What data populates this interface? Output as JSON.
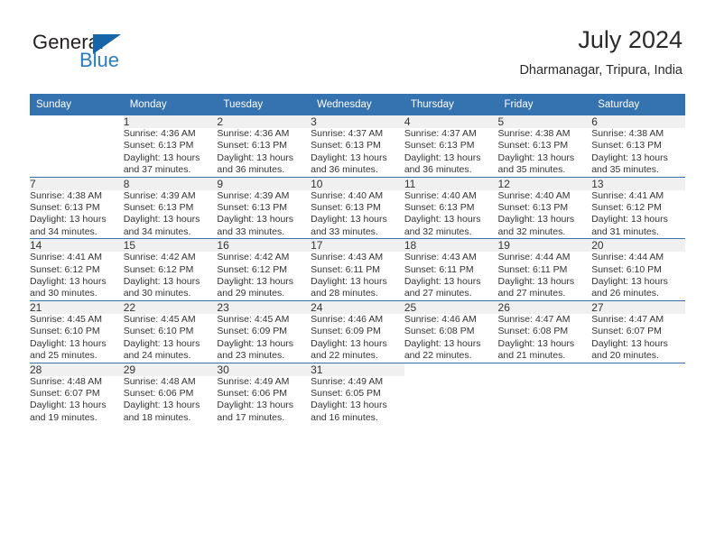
{
  "brand": {
    "name_part1": "General",
    "name_part2": "Blue",
    "flag_color": "#1565a8",
    "blue_color": "#2b7cc2"
  },
  "header": {
    "title": "July 2024",
    "location": "Dharmanagar, Tripura, India"
  },
  "calendar": {
    "header_bg": "#3572b0",
    "daynum_bg": "#f0f0f0",
    "weekdays": [
      "Sunday",
      "Monday",
      "Tuesday",
      "Wednesday",
      "Thursday",
      "Friday",
      "Saturday"
    ],
    "weeks": [
      [
        {
          "day": "",
          "sunrise": "",
          "sunset": "",
          "daylight_line1": "",
          "daylight_line2": ""
        },
        {
          "day": "1",
          "sunrise": "Sunrise: 4:36 AM",
          "sunset": "Sunset: 6:13 PM",
          "daylight_line1": "Daylight: 13 hours",
          "daylight_line2": "and 37 minutes."
        },
        {
          "day": "2",
          "sunrise": "Sunrise: 4:36 AM",
          "sunset": "Sunset: 6:13 PM",
          "daylight_line1": "Daylight: 13 hours",
          "daylight_line2": "and 36 minutes."
        },
        {
          "day": "3",
          "sunrise": "Sunrise: 4:37 AM",
          "sunset": "Sunset: 6:13 PM",
          "daylight_line1": "Daylight: 13 hours",
          "daylight_line2": "and 36 minutes."
        },
        {
          "day": "4",
          "sunrise": "Sunrise: 4:37 AM",
          "sunset": "Sunset: 6:13 PM",
          "daylight_line1": "Daylight: 13 hours",
          "daylight_line2": "and 36 minutes."
        },
        {
          "day": "5",
          "sunrise": "Sunrise: 4:38 AM",
          "sunset": "Sunset: 6:13 PM",
          "daylight_line1": "Daylight: 13 hours",
          "daylight_line2": "and 35 minutes."
        },
        {
          "day": "6",
          "sunrise": "Sunrise: 4:38 AM",
          "sunset": "Sunset: 6:13 PM",
          "daylight_line1": "Daylight: 13 hours",
          "daylight_line2": "and 35 minutes."
        }
      ],
      [
        {
          "day": "7",
          "sunrise": "Sunrise: 4:38 AM",
          "sunset": "Sunset: 6:13 PM",
          "daylight_line1": "Daylight: 13 hours",
          "daylight_line2": "and 34 minutes."
        },
        {
          "day": "8",
          "sunrise": "Sunrise: 4:39 AM",
          "sunset": "Sunset: 6:13 PM",
          "daylight_line1": "Daylight: 13 hours",
          "daylight_line2": "and 34 minutes."
        },
        {
          "day": "9",
          "sunrise": "Sunrise: 4:39 AM",
          "sunset": "Sunset: 6:13 PM",
          "daylight_line1": "Daylight: 13 hours",
          "daylight_line2": "and 33 minutes."
        },
        {
          "day": "10",
          "sunrise": "Sunrise: 4:40 AM",
          "sunset": "Sunset: 6:13 PM",
          "daylight_line1": "Daylight: 13 hours",
          "daylight_line2": "and 33 minutes."
        },
        {
          "day": "11",
          "sunrise": "Sunrise: 4:40 AM",
          "sunset": "Sunset: 6:13 PM",
          "daylight_line1": "Daylight: 13 hours",
          "daylight_line2": "and 32 minutes."
        },
        {
          "day": "12",
          "sunrise": "Sunrise: 4:40 AM",
          "sunset": "Sunset: 6:13 PM",
          "daylight_line1": "Daylight: 13 hours",
          "daylight_line2": "and 32 minutes."
        },
        {
          "day": "13",
          "sunrise": "Sunrise: 4:41 AM",
          "sunset": "Sunset: 6:12 PM",
          "daylight_line1": "Daylight: 13 hours",
          "daylight_line2": "and 31 minutes."
        }
      ],
      [
        {
          "day": "14",
          "sunrise": "Sunrise: 4:41 AM",
          "sunset": "Sunset: 6:12 PM",
          "daylight_line1": "Daylight: 13 hours",
          "daylight_line2": "and 30 minutes."
        },
        {
          "day": "15",
          "sunrise": "Sunrise: 4:42 AM",
          "sunset": "Sunset: 6:12 PM",
          "daylight_line1": "Daylight: 13 hours",
          "daylight_line2": "and 30 minutes."
        },
        {
          "day": "16",
          "sunrise": "Sunrise: 4:42 AM",
          "sunset": "Sunset: 6:12 PM",
          "daylight_line1": "Daylight: 13 hours",
          "daylight_line2": "and 29 minutes."
        },
        {
          "day": "17",
          "sunrise": "Sunrise: 4:43 AM",
          "sunset": "Sunset: 6:11 PM",
          "daylight_line1": "Daylight: 13 hours",
          "daylight_line2": "and 28 minutes."
        },
        {
          "day": "18",
          "sunrise": "Sunrise: 4:43 AM",
          "sunset": "Sunset: 6:11 PM",
          "daylight_line1": "Daylight: 13 hours",
          "daylight_line2": "and 27 minutes."
        },
        {
          "day": "19",
          "sunrise": "Sunrise: 4:44 AM",
          "sunset": "Sunset: 6:11 PM",
          "daylight_line1": "Daylight: 13 hours",
          "daylight_line2": "and 27 minutes."
        },
        {
          "day": "20",
          "sunrise": "Sunrise: 4:44 AM",
          "sunset": "Sunset: 6:10 PM",
          "daylight_line1": "Daylight: 13 hours",
          "daylight_line2": "and 26 minutes."
        }
      ],
      [
        {
          "day": "21",
          "sunrise": "Sunrise: 4:45 AM",
          "sunset": "Sunset: 6:10 PM",
          "daylight_line1": "Daylight: 13 hours",
          "daylight_line2": "and 25 minutes."
        },
        {
          "day": "22",
          "sunrise": "Sunrise: 4:45 AM",
          "sunset": "Sunset: 6:10 PM",
          "daylight_line1": "Daylight: 13 hours",
          "daylight_line2": "and 24 minutes."
        },
        {
          "day": "23",
          "sunrise": "Sunrise: 4:45 AM",
          "sunset": "Sunset: 6:09 PM",
          "daylight_line1": "Daylight: 13 hours",
          "daylight_line2": "and 23 minutes."
        },
        {
          "day": "24",
          "sunrise": "Sunrise: 4:46 AM",
          "sunset": "Sunset: 6:09 PM",
          "daylight_line1": "Daylight: 13 hours",
          "daylight_line2": "and 22 minutes."
        },
        {
          "day": "25",
          "sunrise": "Sunrise: 4:46 AM",
          "sunset": "Sunset: 6:08 PM",
          "daylight_line1": "Daylight: 13 hours",
          "daylight_line2": "and 22 minutes."
        },
        {
          "day": "26",
          "sunrise": "Sunrise: 4:47 AM",
          "sunset": "Sunset: 6:08 PM",
          "daylight_line1": "Daylight: 13 hours",
          "daylight_line2": "and 21 minutes."
        },
        {
          "day": "27",
          "sunrise": "Sunrise: 4:47 AM",
          "sunset": "Sunset: 6:07 PM",
          "daylight_line1": "Daylight: 13 hours",
          "daylight_line2": "and 20 minutes."
        }
      ],
      [
        {
          "day": "28",
          "sunrise": "Sunrise: 4:48 AM",
          "sunset": "Sunset: 6:07 PM",
          "daylight_line1": "Daylight: 13 hours",
          "daylight_line2": "and 19 minutes."
        },
        {
          "day": "29",
          "sunrise": "Sunrise: 4:48 AM",
          "sunset": "Sunset: 6:06 PM",
          "daylight_line1": "Daylight: 13 hours",
          "daylight_line2": "and 18 minutes."
        },
        {
          "day": "30",
          "sunrise": "Sunrise: 4:49 AM",
          "sunset": "Sunset: 6:06 PM",
          "daylight_line1": "Daylight: 13 hours",
          "daylight_line2": "and 17 minutes."
        },
        {
          "day": "31",
          "sunrise": "Sunrise: 4:49 AM",
          "sunset": "Sunset: 6:05 PM",
          "daylight_line1": "Daylight: 13 hours",
          "daylight_line2": "and 16 minutes."
        },
        {
          "day": "",
          "sunrise": "",
          "sunset": "",
          "daylight_line1": "",
          "daylight_line2": ""
        },
        {
          "day": "",
          "sunrise": "",
          "sunset": "",
          "daylight_line1": "",
          "daylight_line2": ""
        },
        {
          "day": "",
          "sunrise": "",
          "sunset": "",
          "daylight_line1": "",
          "daylight_line2": ""
        }
      ]
    ]
  }
}
